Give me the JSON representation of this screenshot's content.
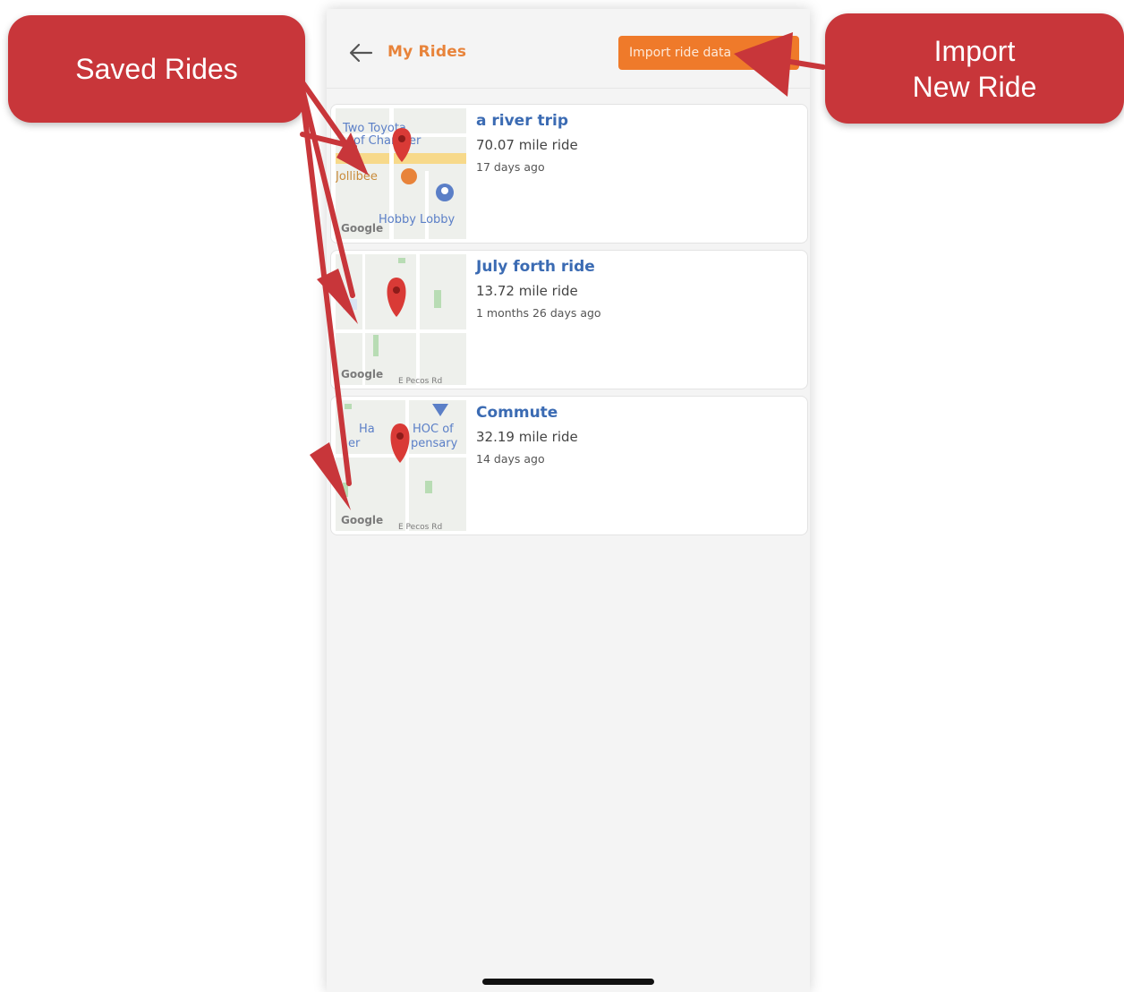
{
  "header": {
    "title": "My Rides",
    "import_button": "Import ride data",
    "back_icon": "arrow-left-icon"
  },
  "rides": [
    {
      "name": "a river trip",
      "distance": "70.07 mile ride",
      "age": "17 days ago",
      "map_labels": [
        "Two Toyota",
        "of Chandler",
        "Jollibee",
        "Hobby Lobby",
        "Google"
      ]
    },
    {
      "name": "July forth ride",
      "distance": "13.72 mile ride",
      "age": "1 months 26 days ago",
      "map_labels": [
        "Google",
        "E Pecos Rd"
      ]
    },
    {
      "name": "Commute",
      "distance": "32.19 mile ride",
      "age": "14 days ago",
      "map_labels": [
        "Ha",
        "HOC of",
        "er",
        "pensary",
        "Google",
        "E Pecos Rd"
      ]
    }
  ],
  "annotations": {
    "saved_rides": "Saved Rides",
    "import_line1": "Import",
    "import_line2": "New Ride",
    "callout_color": "#c8363a"
  },
  "colors": {
    "accent": "#ef7a2a",
    "title": "#e8833a",
    "ride_name": "#3b6bb3",
    "pin": "#d93a36"
  }
}
